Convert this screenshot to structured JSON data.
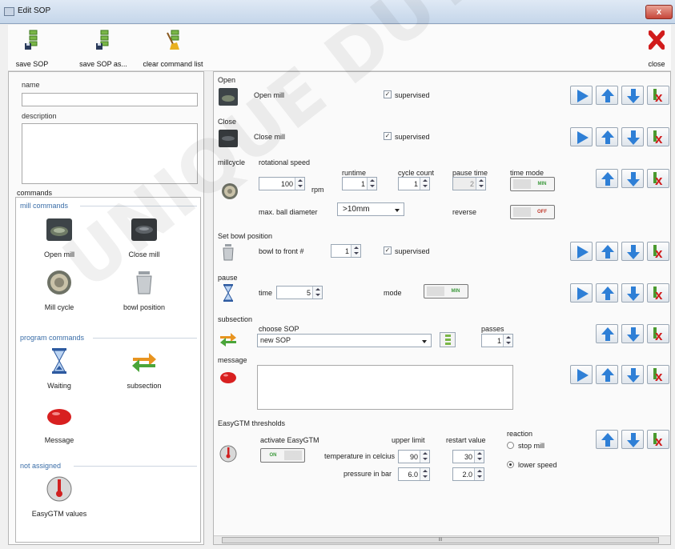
{
  "window": {
    "title": "Edit SOP",
    "close_glyph": "x"
  },
  "toolbar": {
    "save_sop": "save SOP",
    "save_sop_as": "save SOP as...",
    "clear_list": "clear command list",
    "close": "close"
  },
  "left": {
    "name_label": "name",
    "description_label": "description",
    "commands_label": "commands",
    "groups": {
      "mill": "mill commands",
      "program": "program commands",
      "not_assigned": "not assigned"
    },
    "items": {
      "open_mill": "Open mill",
      "close_mill": "Close mill",
      "mill_cycle": "Mill cycle",
      "bowl_position": "bowl position",
      "waiting": "Waiting",
      "subsection": "subsection",
      "message": "Message",
      "easygtm": "EasyGTM values"
    }
  },
  "open": {
    "title": "Open",
    "label": "Open mill",
    "supervised": "supervised"
  },
  "close": {
    "title": "Close",
    "label": "Close mill",
    "supervised": "supervised"
  },
  "millcycle": {
    "title": "millcycle",
    "rot_label": "rotational speed",
    "rot_value": "100",
    "rot_unit": "rpm",
    "runtime_label": "runtime",
    "runtime_value": "1",
    "count_label": "cycle count",
    "count_value": "1",
    "pause_label": "pause time",
    "pause_value": "2",
    "mode_label": "time mode",
    "mode_value": "MIN",
    "ball_label": "max. ball diameter",
    "ball_value": ">10mm",
    "reverse_label": "reverse",
    "reverse_value": "OFF"
  },
  "bowl": {
    "title": "Set bowl position",
    "label": "bowl to front #",
    "value": "1",
    "supervised": "supervised"
  },
  "pause": {
    "title": "pause",
    "time_label": "time",
    "time_value": "5",
    "mode_label": "mode",
    "mode_value": "MIN"
  },
  "subsection": {
    "title": "subsection",
    "choose_label": "choose SOP",
    "choose_value": "new SOP",
    "passes_label": "passes",
    "passes_value": "1"
  },
  "message": {
    "title": "message",
    "text": ""
  },
  "gtm": {
    "title": "EasyGTM thresholds",
    "activate_label": "activate EasyGTM",
    "toggle_on": "ON",
    "toggle_off": "OFF",
    "upper_label": "upper limit",
    "restart_label": "restart value",
    "temp_label": "temperature in celcius",
    "temp_upper": "90",
    "temp_restart": "30",
    "pressure_label": "pressure in bar",
    "pressure_upper": "6.0",
    "pressure_restart": "2.0",
    "reaction_label": "reaction",
    "stop_mill": "stop mill",
    "lower_speed": "lower speed"
  },
  "scrollbar": {
    "thumb": "III"
  },
  "watermark": "UNIQUE DUTSC...",
  "colors": {
    "accent": "#2e7fd6",
    "delete": "#d11c1c",
    "toggle_green": "#3e9a3e",
    "toggle_red": "#c0392b"
  }
}
